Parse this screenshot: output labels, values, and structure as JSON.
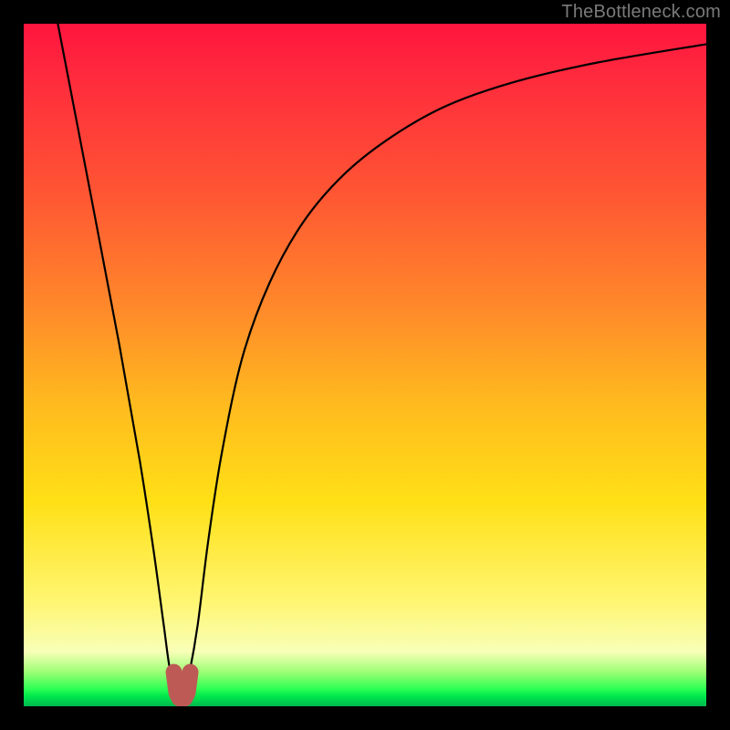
{
  "watermark": "TheBottleneck.com",
  "chart_data": {
    "type": "line",
    "title": "",
    "xlabel": "",
    "ylabel": "",
    "xlim": [
      0,
      100
    ],
    "ylim": [
      0,
      100
    ],
    "series": [
      {
        "name": "bottleneck-curve",
        "x": [
          5,
          10,
          14,
          17,
          19,
          20.5,
          21.5,
          22.7,
          23.5,
          24.3,
          25.5,
          27,
          29,
          32,
          36,
          41,
          47,
          54,
          62,
          72,
          84,
          100
        ],
        "values": [
          100,
          74,
          53,
          36,
          23,
          12,
          5,
          2,
          2,
          5,
          12,
          24,
          37,
          51,
          62,
          71,
          78,
          83.5,
          88,
          91.5,
          94.3,
          97
        ]
      },
      {
        "name": "minimum-marker",
        "x": [
          22.0,
          22.4,
          22.8,
          23.2,
          23.6,
          24.0,
          24.4
        ],
        "values": [
          5.0,
          2.0,
          1.2,
          1.0,
          1.2,
          2.0,
          5.0
        ]
      }
    ],
    "annotations": [],
    "background_gradient": {
      "stops": [
        {
          "pos": 0.0,
          "color": "#ff153e"
        },
        {
          "pos": 0.25,
          "color": "#ff5633"
        },
        {
          "pos": 0.55,
          "color": "#ffb81f"
        },
        {
          "pos": 0.85,
          "color": "#fff674"
        },
        {
          "pos": 0.975,
          "color": "#2bff54"
        },
        {
          "pos": 1.0,
          "color": "#00b84e"
        }
      ]
    }
  }
}
